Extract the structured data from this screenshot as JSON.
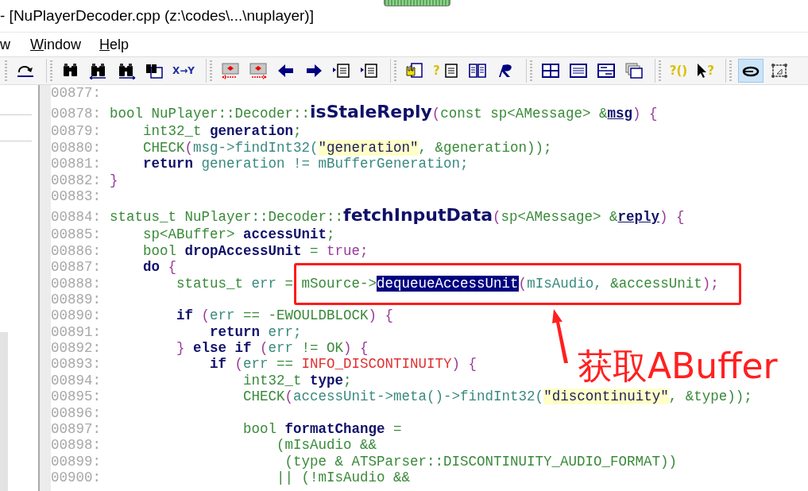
{
  "window": {
    "title": "- [NuPlayerDecoder.cpp (z:\\codes\\...\\nuplayer)]"
  },
  "menu": [
    {
      "label": "w",
      "mnemonic": false
    },
    {
      "label": "Window",
      "mnemonic": true
    },
    {
      "label": "Help",
      "mnemonic": true
    }
  ],
  "toolbar": [
    {
      "buttons": [
        {
          "pressed": false
        }
      ]
    },
    {
      "buttons": [
        {
          "pressed": false
        },
        {
          "pressed": false
        },
        {
          "pressed": false
        },
        {
          "pressed": false
        },
        {
          "pressed": false,
          "label": "X→Y"
        }
      ]
    },
    {
      "buttons": [
        {
          "pressed": false
        },
        {
          "pressed": false
        },
        {
          "pressed": false
        },
        {
          "pressed": false
        },
        {
          "pressed": false
        },
        {
          "pressed": false
        }
      ]
    },
    {
      "buttons": [
        {
          "pressed": false
        },
        {
          "pressed": false,
          "label": "?"
        },
        {
          "pressed": false
        },
        {
          "pressed": false
        }
      ]
    },
    {
      "buttons": [
        {
          "pressed": false
        },
        {
          "pressed": false
        },
        {
          "pressed": false
        },
        {
          "pressed": false
        }
      ]
    },
    {
      "buttons": [
        {
          "pressed": false,
          "label": "?()"
        },
        {
          "pressed": false,
          "label": "?"
        }
      ]
    },
    {
      "buttons": [
        {
          "pressed": true
        },
        {
          "pressed": false
        }
      ]
    }
  ],
  "code": [
    {
      "number": "00877:"
    },
    {
      "number": "00878:",
      "tokens": [
        {
          "kind": "plain",
          "text": "bool NuPlayer::Decoder::"
        },
        {
          "kind": "decl",
          "text": "isStaleReply"
        },
        {
          "kind": "purple",
          "text": "("
        },
        {
          "kind": "plain",
          "text": "const sp<AMessage> &"
        },
        {
          "kind": "param",
          "text": "msg"
        },
        {
          "kind": "purple",
          "text": ") {"
        }
      ]
    },
    {
      "number": "00879:",
      "tokens": [
        {
          "kind": "plain",
          "text": "    int32_t "
        },
        {
          "kind": "var",
          "text": "generation"
        },
        {
          "kind": "plain",
          "text": ";"
        }
      ]
    },
    {
      "number": "00880:",
      "tokens": [
        {
          "kind": "plain",
          "text": "    CHECK"
        },
        {
          "kind": "purple",
          "text": "("
        },
        {
          "kind": "ident",
          "text": "msg->findInt32("
        },
        {
          "kind": "str",
          "text": "\"generation\""
        },
        {
          "kind": "plain",
          "text": ", &generation));"
        }
      ]
    },
    {
      "number": "00881:",
      "tokens": [
        {
          "kind": "kw",
          "text": "    return"
        },
        {
          "kind": "ident",
          "text": " generation != mBufferGeneration;"
        }
      ]
    },
    {
      "number": "00882:",
      "tokens": [
        {
          "kind": "purple",
          "text": "}"
        }
      ]
    },
    {
      "number": "00883:"
    },
    {
      "number": "00884:",
      "tokens": [
        {
          "kind": "plain",
          "text": "status_t NuPlayer::Decoder::"
        },
        {
          "kind": "decl",
          "text": "fetchInputData"
        },
        {
          "kind": "purple",
          "text": "("
        },
        {
          "kind": "plain",
          "text": "sp<AMessage> &"
        },
        {
          "kind": "param",
          "text": "reply"
        },
        {
          "kind": "purple",
          "text": ") {"
        }
      ]
    },
    {
      "number": "00885:",
      "tokens": [
        {
          "kind": "plain",
          "text": "    sp<ABuffer> "
        },
        {
          "kind": "var",
          "text": "accessUnit"
        },
        {
          "kind": "plain",
          "text": ";"
        }
      ]
    },
    {
      "number": "00886:",
      "tokens": [
        {
          "kind": "plain",
          "text": "    bool "
        },
        {
          "kind": "var",
          "text": "dropAccessUnit"
        },
        {
          "kind": "plain",
          "text": " = "
        },
        {
          "kind": "purple",
          "text": "true;"
        }
      ]
    },
    {
      "number": "00887:",
      "tokens": [
        {
          "kind": "kw",
          "text": "    do"
        },
        {
          "kind": "purple",
          "text": " {"
        }
      ]
    },
    {
      "number": "00888:",
      "tokens": [
        {
          "kind": "plain",
          "text": "        status_t "
        },
        {
          "kind": "ident",
          "text": "err"
        },
        {
          "kind": "plain",
          "text": " = mSource->"
        },
        {
          "kind": "sel",
          "text": "dequeueAccessUnit"
        },
        {
          "kind": "purple",
          "text": "("
        },
        {
          "kind": "ident",
          "text": "mIsAudio, "
        },
        {
          "kind": "plain",
          "text": "&accessUnit"
        },
        {
          "kind": "purple",
          "text": ");"
        }
      ]
    },
    {
      "number": "00889:"
    },
    {
      "number": "00890:",
      "tokens": [
        {
          "kind": "kw",
          "text": "        if"
        },
        {
          "kind": "purple",
          "text": " ("
        },
        {
          "kind": "ident",
          "text": "err"
        },
        {
          "kind": "plain",
          "text": " == -EWOULDBLOCK"
        },
        {
          "kind": "purple",
          "text": ") {"
        }
      ]
    },
    {
      "number": "00891:",
      "tokens": [
        {
          "kind": "kw",
          "text": "            return"
        },
        {
          "kind": "ident",
          "text": " err;"
        }
      ]
    },
    {
      "number": "00892:",
      "tokens": [
        {
          "kind": "purple",
          "text": "        }"
        },
        {
          "kind": "kw",
          "text": " else if"
        },
        {
          "kind": "purple",
          "text": " ("
        },
        {
          "kind": "ident",
          "text": "err"
        },
        {
          "kind": "plain",
          "text": " != OK"
        },
        {
          "kind": "purple",
          "text": ") {"
        }
      ]
    },
    {
      "number": "00893:",
      "tokens": [
        {
          "kind": "kw",
          "text": "            if"
        },
        {
          "kind": "purple",
          "text": " ("
        },
        {
          "kind": "ident",
          "text": "err"
        },
        {
          "kind": "plain",
          "text": " == "
        },
        {
          "kind": "const",
          "text": "INFO_DISCONTINUITY"
        },
        {
          "kind": "purple",
          "text": ") {"
        }
      ]
    },
    {
      "number": "00894:",
      "tokens": [
        {
          "kind": "plain",
          "text": "                int32_t "
        },
        {
          "kind": "var",
          "text": "type"
        },
        {
          "kind": "plain",
          "text": ";"
        }
      ]
    },
    {
      "number": "00895:",
      "tokens": [
        {
          "kind": "plain",
          "text": "                CHECK"
        },
        {
          "kind": "purple",
          "text": "("
        },
        {
          "kind": "ident",
          "text": "accessUnit->meta()->findInt32("
        },
        {
          "kind": "str",
          "text": "\"discontinuity\""
        },
        {
          "kind": "plain",
          "text": ", &type));"
        }
      ]
    },
    {
      "number": "00896:"
    },
    {
      "number": "00897:",
      "tokens": [
        {
          "kind": "plain",
          "text": "                bool "
        },
        {
          "kind": "var",
          "text": "formatChange"
        },
        {
          "kind": "plain",
          "text": " ="
        }
      ]
    },
    {
      "number": "00898:",
      "tokens": [
        {
          "kind": "plain",
          "text": "                    (mIsAudio &&"
        }
      ]
    },
    {
      "number": "00899:",
      "tokens": [
        {
          "kind": "plain",
          "text": "                     (type & ATSParser::DISCONTINUITY_AUDIO_FORMAT))"
        }
      ]
    },
    {
      "number": "00900:",
      "tokens": [
        {
          "kind": "plain",
          "text": "                    || (!mIsAudio &&"
        }
      ]
    }
  ],
  "annotation": {
    "text": "获取ABuffer"
  }
}
